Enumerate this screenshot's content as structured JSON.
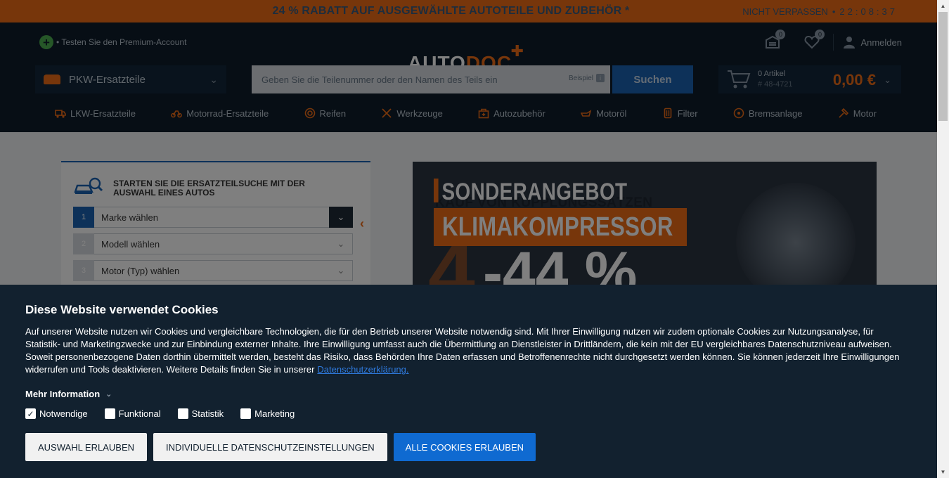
{
  "promo": {
    "text": "24 % RABATT AUF AUSGEWÄHLTE AUTOTEILE UND ZUBEHÖR *",
    "cta": "NICHT VERPASSEN",
    "bullet": "•",
    "timer": "22:08:37"
  },
  "header": {
    "premium": "• Testen Sie den Premium-Account",
    "logo_a": "AUTO",
    "logo_b": "DOC",
    "garage_count": "0",
    "wishlist_count": "0",
    "login": "Anmelden"
  },
  "search": {
    "category": "PKW-Ersatzteile",
    "placeholder": "Geben Sie die Teilenummer oder den Namen des Teils ein",
    "example_label": "Beispiel",
    "button": "Suchen"
  },
  "cart": {
    "items": "0 Artikel",
    "number": "# 48-4721",
    "total": "0,00 €"
  },
  "nav": [
    {
      "label": "LKW-Ersatzteile",
      "icon": "truck-icon"
    },
    {
      "label": "Motorrad-Ersatzteile",
      "icon": "motorcycle-icon"
    },
    {
      "label": "Reifen",
      "icon": "tire-icon"
    },
    {
      "label": "Werkzeuge",
      "icon": "tools-icon"
    },
    {
      "label": "Autozubehör",
      "icon": "accessory-icon"
    },
    {
      "label": "Motoröl",
      "icon": "oil-icon"
    },
    {
      "label": "Filter",
      "icon": "filter-icon"
    },
    {
      "label": "Bremsanlage",
      "icon": "brake-icon"
    },
    {
      "label": "Motor",
      "icon": "engine-icon"
    }
  ],
  "finder": {
    "title": "STARTEN SIE DIE ERSATZTEILSUCHE MIT DER AUSWAHL EINES AUTOS",
    "steps": [
      {
        "num": "1",
        "label": "Marke wählen"
      },
      {
        "num": "2",
        "label": "Modell wählen"
      },
      {
        "num": "3",
        "label": "Motor (Typ) wählen"
      }
    ]
  },
  "banner": {
    "title": "SONDERANGEBOT",
    "subtitle": "KAUF VON KUPPLUNGSSÄTZEN",
    "product": "KLIMAKOMPRESSOR",
    "discount": "-44 %"
  },
  "cookie": {
    "title": "Diese Website verwendet Cookies",
    "body": "Auf unserer Website nutzen wir Cookies und vergleichbare Technologien, die für den Betrieb unserer Website notwendig sind. Mit Ihrer Einwilligung nutzen wir zudem optionale Cookies zur Nutzungsanalyse, für Statistik- und Marketingzwecke und zur Einbindung externer Inhalte. Ihre Einwilligung umfasst auch die Übermittlung an Dienstleister in Drittländern, die kein mit der EU vergleichbares Datenschutzniveau aufweisen. Soweit personenbezogene Daten dorthin übermittelt werden, besteht das Risiko, dass Behörden Ihre Daten erfassen und Betroffenenrechte nicht durchgesetzt werden können. Sie können jederzeit Ihre Einwilligungen widerrufen und Tools deaktivieren. Weitere Details finden Sie in unserer",
    "link": "Datenschutzerklärung.",
    "more": "Mehr Information",
    "checks": [
      {
        "label": "Notwendige",
        "checked": true
      },
      {
        "label": "Funktional",
        "checked": false
      },
      {
        "label": "Statistik",
        "checked": false
      },
      {
        "label": "Marketing",
        "checked": false
      }
    ],
    "btn_selection": "AUSWAHL ERLAUBEN",
    "btn_individual": "INDIVIDUELLE DATENSCHUTZEINSTELLUNGEN",
    "btn_all": "ALLE COOKIES ERLAUBEN"
  },
  "colors": {
    "accent": "#ee6c16",
    "header_bg": "#0e1d2b",
    "primary_blue": "#0f6ad1",
    "cookie_bg": "#12212f"
  }
}
